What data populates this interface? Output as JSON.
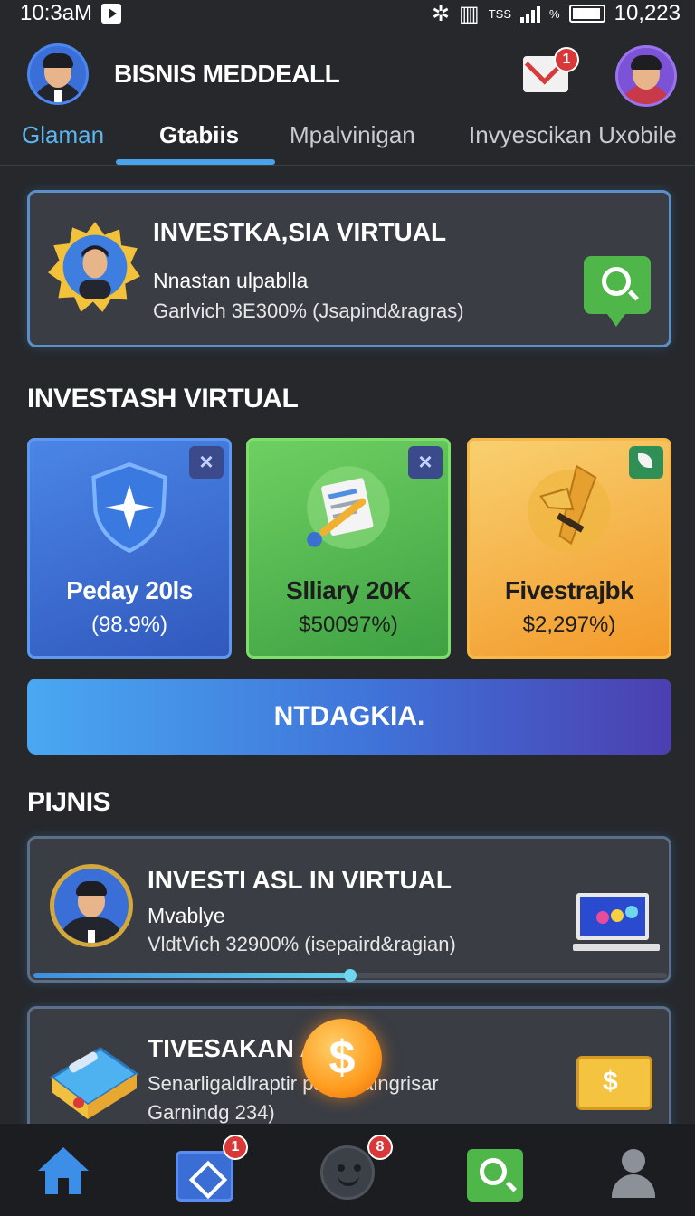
{
  "status_bar": {
    "time": "10:3aM",
    "network_label": "TSS",
    "percent_symbol": "%",
    "battery_value": "10,223"
  },
  "header": {
    "title": "BISNIS MEDDEALL",
    "mail_badge_count": "1"
  },
  "tabs": [
    {
      "label": "Glaman"
    },
    {
      "label": "Gtabiis"
    },
    {
      "label": "Mpalvinigan"
    },
    {
      "label": "Invyescikan Uxobile"
    }
  ],
  "feature_card": {
    "title": "INVESTKA,SIA VIRTUAL",
    "subtitle": "Nnastan ulpablla",
    "detail": "Garlvich 3E300%  (Jsapind&ragras)"
  },
  "section_virtual": {
    "heading": "INVESTASH VIRTUAL",
    "tiles": [
      {
        "name": "Peday 20ls",
        "value": "(98.9%)",
        "close_label": "×"
      },
      {
        "name": "Slliary 20K",
        "value": "$50097%)",
        "close_label": "×"
      },
      {
        "name": "Fivestrajbk",
        "value": "$2,297%)"
      }
    ],
    "cta_label": "NTDAGKIA."
  },
  "section_pijnis": {
    "heading": "PIJNIS",
    "items": [
      {
        "title": "INVESTI ASL IN VIRTUAL",
        "subtitle": "Mvablye",
        "detail": "VldtVich 32900%  (isepaird&ragian)",
        "progress": 0.5
      },
      {
        "title": "TIVESAKAN  AL",
        "subtitle": "Senarligaldlraptir   paalanalngrisar",
        "detail": "Garnindg 234)",
        "coin_symbol": "$",
        "card_symbol": "$"
      }
    ]
  },
  "bottom_nav": {
    "wallet_badge": "1",
    "smile_badge": "8"
  },
  "colors": {
    "background": "#26282c",
    "accent_blue": "#4aa2e8",
    "green": "#4fb64a",
    "orange": "#f39a2a",
    "badge_red": "#d93838"
  }
}
